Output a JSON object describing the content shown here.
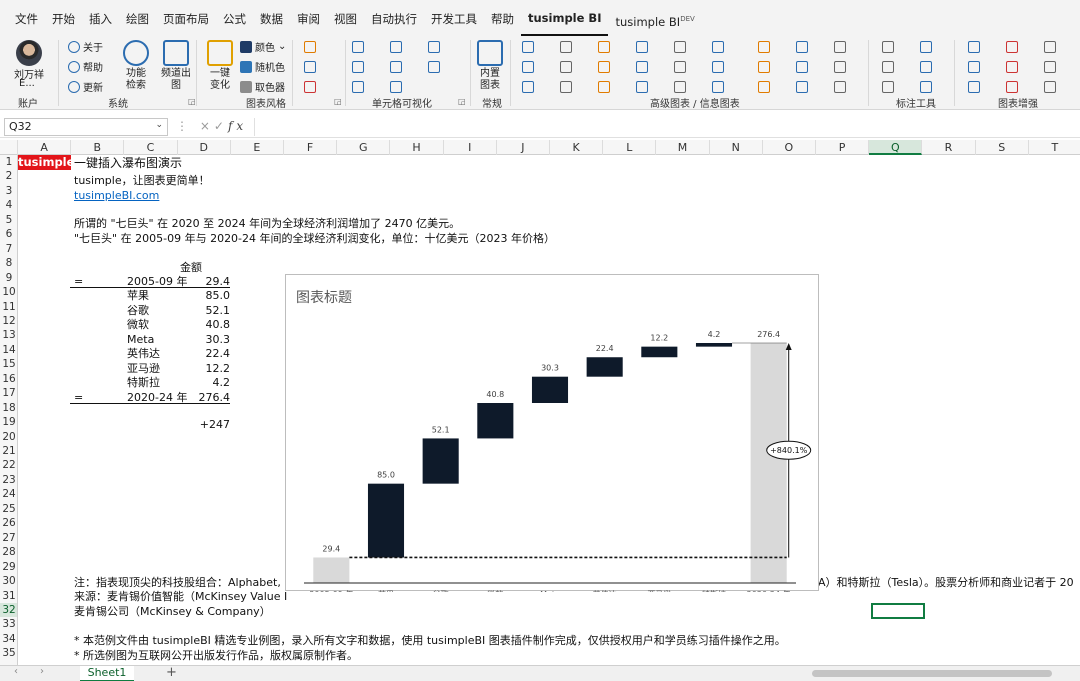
{
  "menu": {
    "tabs": [
      "文件",
      "开始",
      "插入",
      "绘图",
      "页面布局",
      "公式",
      "数据",
      "审阅",
      "视图",
      "自动执行",
      "开发工具",
      "帮助",
      "tusimple BI",
      "tusimple BI"
    ],
    "active_index": 12,
    "last_tab_superscript": "DEV"
  },
  "ribbon": {
    "account": {
      "name_line1": "刘万祥",
      "name_line2": "E...",
      "group": "账户"
    },
    "system": {
      "about": "关于",
      "help": "帮助",
      "update": "更新",
      "group": "系统"
    },
    "big_buttons": [
      {
        "line1": "功能",
        "line2": "检索"
      },
      {
        "line1": "频道出",
        "line2": "图"
      },
      {
        "line1": "一键",
        "line2": "变化"
      }
    ],
    "style": {
      "color": "颜色",
      "random_color": "随机色",
      "take_color": "取色器",
      "group": "图表风格"
    },
    "cell_format": {
      "group": "单元格可视化"
    },
    "common": {
      "line1": "内置",
      "line2": "图表",
      "group": "常规"
    },
    "advanced_group": "高级图表 / 信息图表",
    "annotation_group": "标注工具",
    "enhance_group": "图表增强"
  },
  "formula_bar": {
    "name_box": "Q32",
    "cancel": "×",
    "enter": "✓",
    "fx": "fx",
    "content": ""
  },
  "columns": [
    "A",
    "B",
    "C",
    "D",
    "E",
    "F",
    "G",
    "H",
    "I",
    "J",
    "K",
    "L",
    "M",
    "N",
    "O",
    "P",
    "Q",
    "R",
    "S",
    "T"
  ],
  "selected_column": "Q",
  "rows": [
    "1",
    "2",
    "3",
    "4",
    "5",
    "6",
    "7",
    "8",
    "9",
    "10",
    "11",
    "12",
    "13",
    "14",
    "15",
    "16",
    "17",
    "18",
    "19",
    "20",
    "21",
    "22",
    "23",
    "24",
    "25",
    "26",
    "27",
    "28",
    "29",
    "30",
    "31",
    "32",
    "33",
    "34",
    "35"
  ],
  "selected_row": "32",
  "sheet": {
    "brand": "tusimple",
    "r1": "一键插入瀑布图演示",
    "r2": "tusimple，让图表更简单！",
    "r3": "tusimpleBI.com",
    "r5": "所谓的 \"七巨头\" 在 2020 至 2024 年间为全球经济利润增加了 2470 亿美元。",
    "r6": "\"七巨头\" 在 2005-09 年与 2020-24 年间的全球经济利润变化，单位：十亿美元（2023 年价格）",
    "amount_header": "金额",
    "table": [
      {
        "sign": "=",
        "label": "2005-09 年",
        "value": "29.4"
      },
      {
        "sign": "",
        "label": "苹果",
        "value": "85.0"
      },
      {
        "sign": "",
        "label": "谷歌",
        "value": "52.1"
      },
      {
        "sign": "",
        "label": "微软",
        "value": "40.8"
      },
      {
        "sign": "",
        "label": "Meta",
        "value": "30.3"
      },
      {
        "sign": "",
        "label": "英伟达",
        "value": "22.4"
      },
      {
        "sign": "",
        "label": "亚马逊",
        "value": "12.2"
      },
      {
        "sign": "",
        "label": "特斯拉",
        "value": "4.2"
      },
      {
        "sign": "=",
        "label": "2020-24 年",
        "value": "276.4"
      }
    ],
    "delta": "+247",
    "r30_left": "注：指表现顶尖的科技股组合：Alphabet,",
    "r30_right": "A）和特斯拉（Tesla）。股票分析师和商业记者于 20",
    "r31": "来源：麦肯锡价值智能（McKinsey Value I",
    "r32": "麦肯锡公司（McKinsey & Company）",
    "r34": "* 本范例文件由 tusimpleBI 精选专业例图，录入所有文字和数据，使用 tusimpleBI 图表插件制作完成，仅供授权用户和学员练习插件操作之用。",
    "r35": "* 所选例图为互联网公开出版发行作品，版权属原制作者。"
  },
  "chart_data": {
    "type": "bar",
    "subtype": "waterfall",
    "title": "图表标题",
    "categories": [
      "2005-09 年",
      "苹果",
      "谷歌",
      "微软",
      "Meta",
      "英伟达",
      "亚马逊",
      "特斯拉",
      "2020-24 年"
    ],
    "values": [
      29.4,
      85.0,
      52.1,
      40.8,
      30.3,
      22.4,
      12.2,
      4.2,
      276.4
    ],
    "data_labels": [
      "29.4",
      "85.0",
      "52.1",
      "40.8",
      "30.3",
      "22.4",
      "12.2",
      "4.2",
      "276.4"
    ],
    "kinds": [
      "total",
      "delta",
      "delta",
      "delta",
      "delta",
      "delta",
      "delta",
      "delta",
      "total"
    ],
    "annotation": "+840.1%",
    "ylim": [
      0,
      276.4
    ],
    "colors": {
      "total": "#d9d9d9",
      "delta": "#0e1a2a",
      "baseline": "#111111"
    }
  },
  "tabs": {
    "sheet": "Sheet1",
    "add": "+"
  }
}
